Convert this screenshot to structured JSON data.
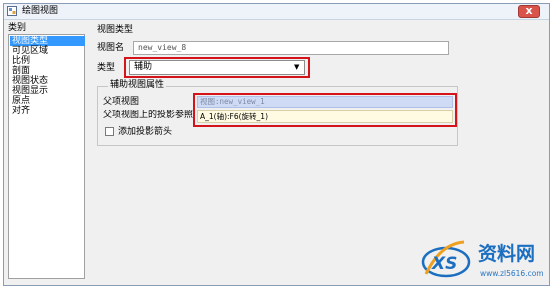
{
  "window": {
    "title": "绘图视图",
    "close_glyph": "x"
  },
  "categories": {
    "label": "类别",
    "items": [
      {
        "label": "视图类型",
        "selected": true
      },
      {
        "label": "可见区域",
        "selected": false
      },
      {
        "label": "比例",
        "selected": false
      },
      {
        "label": "剖面",
        "selected": false
      },
      {
        "label": "视图状态",
        "selected": false
      },
      {
        "label": "视图显示",
        "selected": false
      },
      {
        "label": "原点",
        "selected": false
      },
      {
        "label": "对齐",
        "selected": false
      }
    ]
  },
  "panel": {
    "title": "视图类型",
    "view_name_label": "视图名",
    "view_name_value": "new_view_8",
    "type_label": "类型",
    "type_value": "辅助",
    "group": {
      "title": "辅助视图属性",
      "parent_view_label": "父项视图",
      "parent_view_value": "视图:new_view_1",
      "projection_ref_label": "父项视图上的投影参照",
      "projection_ref_value": "A_1(轴):F6(旋转_1)",
      "add_arrow_label": "添加投影箭头",
      "add_arrow_checked": false
    }
  },
  "watermark": {
    "text": "资料网",
    "url": "www.zl5616.com",
    "logo_letters": "XS"
  },
  "colors": {
    "selection": "#3399ff",
    "highlight_box": "#d4131b",
    "watermark": "#1c6fc0"
  },
  "icons": {
    "title": "drawing-view-icon",
    "dropdown": "chevron-down-icon",
    "close": "close-icon"
  }
}
